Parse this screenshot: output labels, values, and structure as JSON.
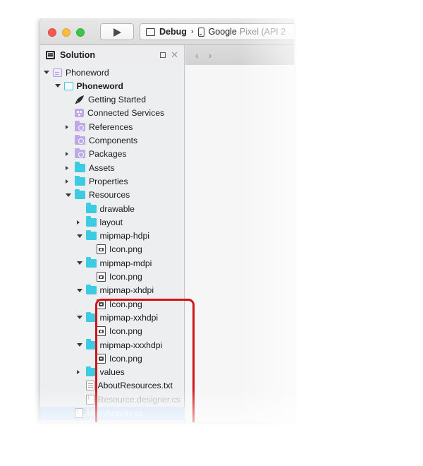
{
  "window": {
    "toolbar": {
      "run_button": "run-play",
      "traffic_lights": [
        "close",
        "minimize",
        "zoom"
      ],
      "config": {
        "build_label": "Debug",
        "separator": "›",
        "device_label": "Google",
        "device_label_faded": "Pixel (API 2"
      }
    },
    "panel_header": {
      "title": "Solution",
      "pin_label": "▫",
      "close_label": "✕",
      "nav_back": "‹",
      "nav_forward": "›"
    }
  },
  "tree": [
    {
      "label": "Phoneword",
      "indent": 0,
      "twisty": "open",
      "icon": "solution",
      "style": "normal"
    },
    {
      "label": "Phoneword",
      "indent": 1,
      "twisty": "open",
      "icon": "project",
      "style": "bold"
    },
    {
      "label": "Getting Started",
      "indent": 2,
      "twisty": "none",
      "icon": "rocket",
      "style": "normal"
    },
    {
      "label": "Connected Services",
      "indent": 2,
      "twisty": "none",
      "icon": "service",
      "style": "normal"
    },
    {
      "label": "References",
      "indent": 2,
      "twisty": "closed",
      "icon": "folder-purple",
      "style": "normal"
    },
    {
      "label": "Components",
      "indent": 2,
      "twisty": "none",
      "icon": "folder-purple",
      "style": "normal"
    },
    {
      "label": "Packages",
      "indent": 2,
      "twisty": "closed",
      "icon": "folder-purple",
      "style": "normal"
    },
    {
      "label": "Assets",
      "indent": 2,
      "twisty": "closed",
      "icon": "folder",
      "style": "normal"
    },
    {
      "label": "Properties",
      "indent": 2,
      "twisty": "closed",
      "icon": "folder",
      "style": "normal"
    },
    {
      "label": "Resources",
      "indent": 2,
      "twisty": "open",
      "icon": "folder",
      "style": "normal"
    },
    {
      "label": "drawable",
      "indent": 3,
      "twisty": "none",
      "icon": "folder",
      "style": "normal"
    },
    {
      "label": "layout",
      "indent": 3,
      "twisty": "closed",
      "icon": "folder",
      "style": "normal"
    },
    {
      "label": "mipmap-hdpi",
      "indent": 3,
      "twisty": "open",
      "icon": "folder",
      "style": "normal"
    },
    {
      "label": "Icon.png",
      "indent": 4,
      "twisty": "none",
      "icon": "png",
      "style": "normal"
    },
    {
      "label": "mipmap-mdpi",
      "indent": 3,
      "twisty": "open",
      "icon": "folder",
      "style": "normal"
    },
    {
      "label": "Icon.png",
      "indent": 4,
      "twisty": "none",
      "icon": "png",
      "style": "normal"
    },
    {
      "label": "mipmap-xhdpi",
      "indent": 3,
      "twisty": "open",
      "icon": "folder",
      "style": "normal"
    },
    {
      "label": "Icon.png",
      "indent": 4,
      "twisty": "none",
      "icon": "png",
      "style": "normal"
    },
    {
      "label": "mipmap-xxhdpi",
      "indent": 3,
      "twisty": "open",
      "icon": "folder",
      "style": "normal"
    },
    {
      "label": "Icon.png",
      "indent": 4,
      "twisty": "none",
      "icon": "png",
      "style": "normal"
    },
    {
      "label": "mipmap-xxxhdpi",
      "indent": 3,
      "twisty": "open",
      "icon": "folder",
      "style": "normal"
    },
    {
      "label": "Icon.png",
      "indent": 4,
      "twisty": "none",
      "icon": "png",
      "style": "normal"
    },
    {
      "label": "values",
      "indent": 3,
      "twisty": "closed",
      "icon": "folder",
      "style": "normal"
    },
    {
      "label": "AboutResources.txt",
      "indent": 3,
      "twisty": "none",
      "icon": "doc",
      "style": "normal"
    },
    {
      "label": "Resource.designer.cs",
      "indent": 3,
      "twisty": "none",
      "icon": "doc-cs",
      "style": "dim"
    },
    {
      "label": "MainActivity.cs",
      "indent": 2,
      "twisty": "none",
      "icon": "doc-cs",
      "style": "selected"
    }
  ],
  "annotation": {
    "highlight_color": "#d4121a",
    "highlight_label": "mipmap-folders-highlight"
  },
  "colors": {
    "folder_cyan": "#3ccbe2",
    "folder_purple": "#bfa8e8",
    "selection_blue": "#d3e3f5",
    "sidebar_bg": "#eceef0",
    "editor_bg": "#f6f6f6"
  }
}
